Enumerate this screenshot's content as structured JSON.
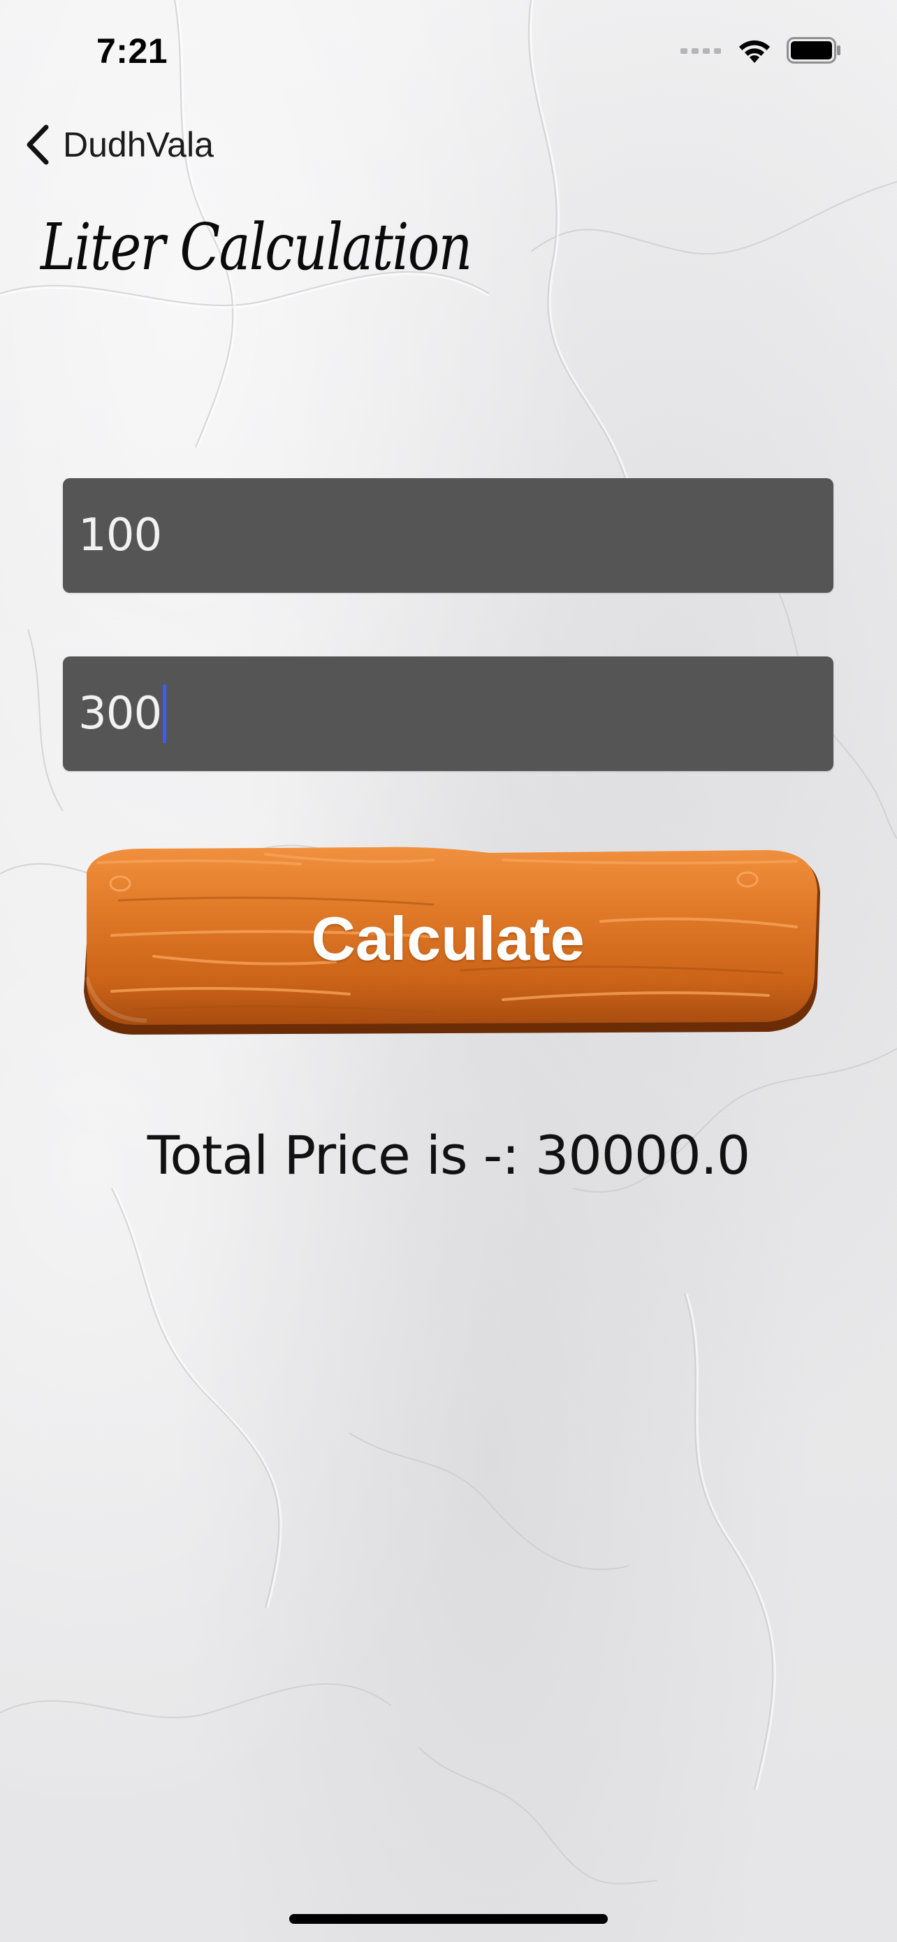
{
  "status_bar": {
    "time": "7:21"
  },
  "nav": {
    "back_label": "DudhVala"
  },
  "page": {
    "title": "Liter Calculation"
  },
  "form": {
    "field_1_value": "100",
    "field_2_value": "300",
    "calculate_label": "Calculate"
  },
  "result": {
    "text": "Total Price is -: 30000.0"
  },
  "colors": {
    "field_background": "#555555",
    "caret": "#3a5bff",
    "button_wood": "#d2661c"
  }
}
